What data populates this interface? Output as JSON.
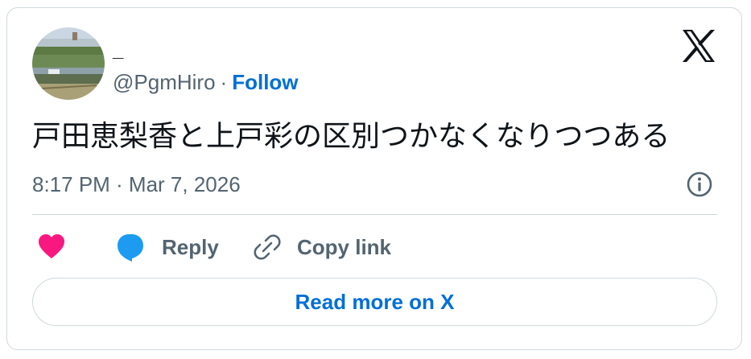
{
  "author": {
    "display_name": "_",
    "handle": "@PgmHiro",
    "separator": "·",
    "follow_label": "Follow"
  },
  "tweet": {
    "text": "戸田恵梨香と上戸彩の区別つかなくなりつつある",
    "timestamp": "8:17 PM · Mar 7, 2026"
  },
  "actions": {
    "reply_label": "Reply",
    "copy_link_label": "Copy link"
  },
  "footer": {
    "read_more_label": "Read more on X"
  },
  "colors": {
    "accent_blue": "#006fd6",
    "heart_pink": "#f91880",
    "reply_blue": "#1d9bf0",
    "secondary_text": "#536471",
    "border": "#cfd9de"
  },
  "icons": {
    "brand": "x-logo-icon",
    "info": "info-icon",
    "like": "heart-icon",
    "reply": "reply-bubble-icon",
    "copy": "link-icon"
  }
}
